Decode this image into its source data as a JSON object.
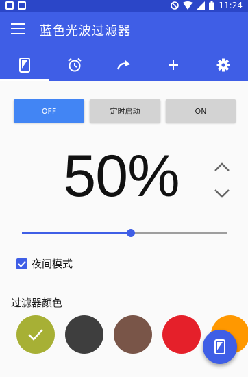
{
  "status_bar": {
    "time": "11:24"
  },
  "app": {
    "title": "蓝色光波过滤器"
  },
  "tabs": [
    {
      "icon": "phone-screen-icon",
      "active": true
    },
    {
      "icon": "alarm-clock-icon",
      "active": false
    },
    {
      "icon": "redo-arrow-icon",
      "active": false
    },
    {
      "icon": "plus-icon",
      "active": false
    },
    {
      "icon": "gear-icon",
      "active": false
    }
  ],
  "mode_buttons": {
    "off": "OFF",
    "timer": "定时启动",
    "on": "ON",
    "selected": "off"
  },
  "intensity": {
    "display": "50%",
    "value": 0.53
  },
  "night_mode": {
    "label": "夜间模式",
    "checked": true
  },
  "filter_color": {
    "label": "过滤器颜色",
    "swatches": [
      {
        "color": "#a7b035",
        "selected": true
      },
      {
        "color": "#3e3e3e",
        "selected": false
      },
      {
        "color": "#795548",
        "selected": false
      },
      {
        "color": "#e5202a",
        "selected": false
      },
      {
        "color": "#ff9800",
        "selected": false
      }
    ]
  },
  "colors": {
    "primary": "#3f5ee6",
    "status_bar": "#2b46c8",
    "accent_blue": "#4285f4"
  }
}
